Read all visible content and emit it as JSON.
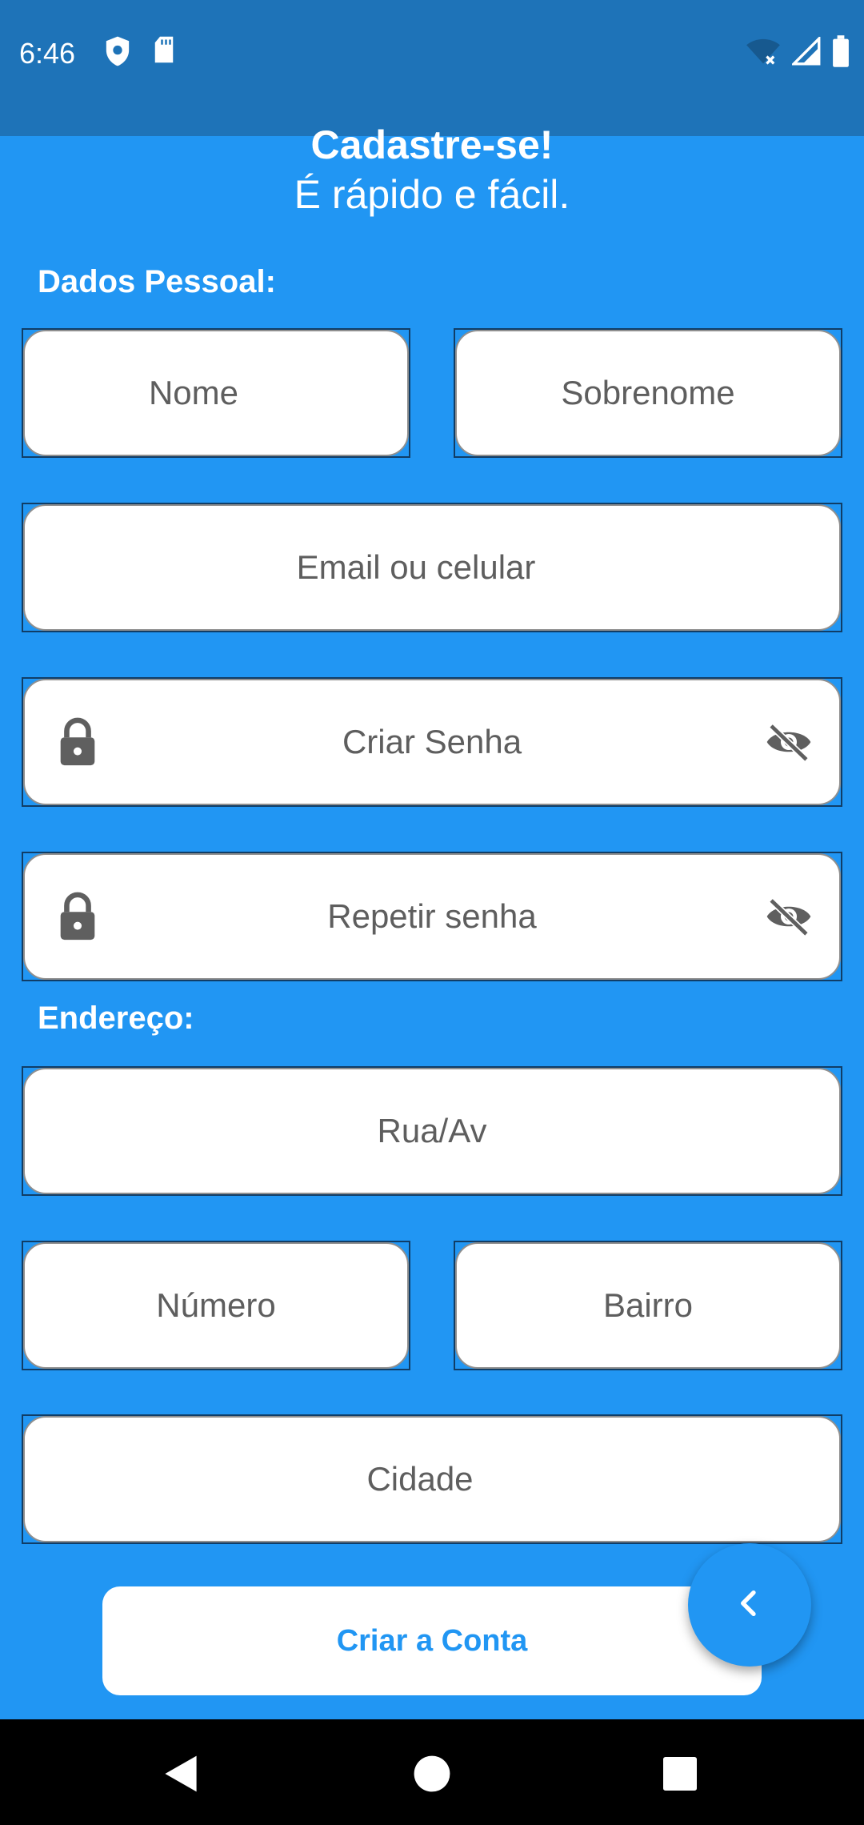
{
  "status_bar": {
    "time": "6:46",
    "icons": [
      "shield-icon",
      "sd-card-icon",
      "wifi-off-icon",
      "signal-icon",
      "battery-icon"
    ]
  },
  "header": {
    "title": "Cadastre-se!",
    "subtitle": "É rápido e fácil."
  },
  "sections": {
    "personal_label": "Dados Pessoal:",
    "address_label": "Endereço:"
  },
  "fields": {
    "first_name": {
      "placeholder": "Nome",
      "value": ""
    },
    "last_name": {
      "placeholder": "Sobrenome",
      "value": ""
    },
    "email_phone": {
      "placeholder": "Email ou celular",
      "value": ""
    },
    "password": {
      "placeholder": "Criar Senha",
      "value": ""
    },
    "password_repeat": {
      "placeholder": "Repetir senha",
      "value": ""
    },
    "street": {
      "placeholder": "Rua/Av",
      "value": ""
    },
    "number": {
      "placeholder": "Número",
      "value": ""
    },
    "neighborhood": {
      "placeholder": "Bairro",
      "value": ""
    },
    "city": {
      "placeholder": "Cidade",
      "value": ""
    }
  },
  "actions": {
    "create_account": "Criar a Conta"
  },
  "colors": {
    "background": "#2196F3",
    "status_bar": "#1E73B8",
    "field_border": "#103D66",
    "button_text": "#2196F3"
  },
  "nav_bar": {
    "buttons": [
      "back-icon",
      "home-icon",
      "recents-icon"
    ]
  }
}
